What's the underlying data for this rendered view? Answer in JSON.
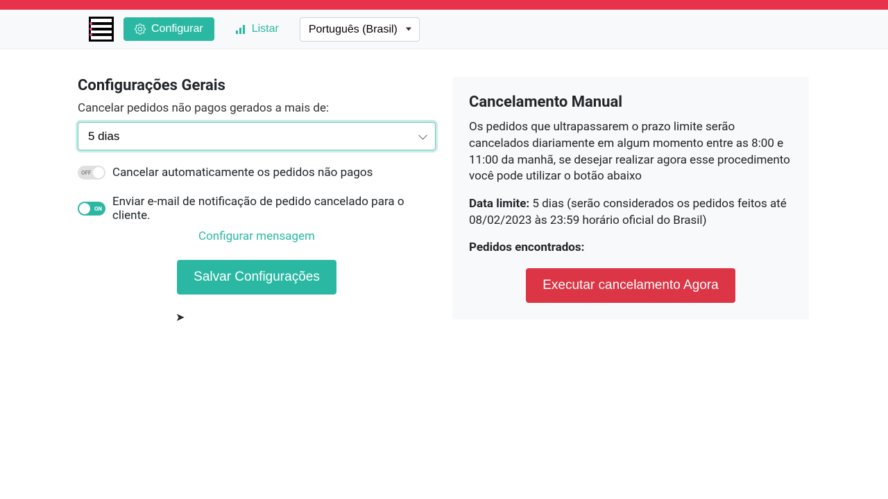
{
  "toolbar": {
    "configure_label": "Configurar",
    "list_label": "Listar",
    "language_selected": "Português (Brasil)"
  },
  "general": {
    "title": "Configurações Gerais",
    "cancel_label": "Cancelar pedidos não pagos gerados a mais de:",
    "days_selected": "5 dias",
    "toggle1": {
      "state_text": "OFF",
      "label": "Cancelar automaticamente os pedidos não pagos"
    },
    "toggle2": {
      "state_text": "ON",
      "label": "Enviar e-mail de notificação de pedido cancelado para o cliente."
    },
    "configure_message_link": "Configurar mensagem",
    "save_button": "Salvar Configurações"
  },
  "manual_cancel": {
    "title": "Cancelamento Manual",
    "description": "Os pedidos que ultrapassarem o prazo limite serão cancelados diariamente em algum momento entre as 8:00 e 11:00 da manhã, se desejar realizar agora esse procedimento você pode utilizar o botão abaixo",
    "limit_label": "Data limite:",
    "limit_value": "5 dias (serão considerados os pedidos feitos até 08/02/2023 às 23:59 horário oficial do Brasil)",
    "found_label": "Pedidos encontrados:",
    "execute_button": "Executar cancelamento Agora"
  }
}
